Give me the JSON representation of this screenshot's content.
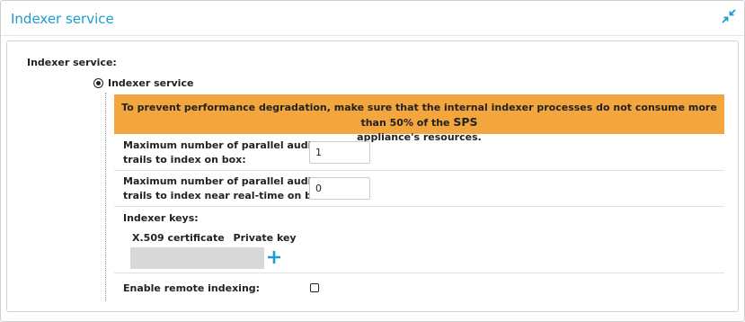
{
  "panel": {
    "title": "Indexer service",
    "collapse_icon": "collapse-arrows-icon"
  },
  "section": {
    "label": "Indexer service:",
    "option_label": "Indexer service",
    "option_selected": true
  },
  "warning": {
    "text_main": "To prevent performance degradation, make sure that the internal indexer processes do not consume more than 50% of the ",
    "text_sps": "SPS",
    "text_end": "appliance's resources."
  },
  "fields": {
    "max_parallel": {
      "label_line1": "Maximum number of parallel audit",
      "label_line2": "trails to index on box:",
      "value": "1"
    },
    "max_parallel_realtime": {
      "label_line1": "Maximum number of parallel audit",
      "label_line2": "trails to index near real-time on box:",
      "value": "0"
    }
  },
  "indexer_keys": {
    "label": "Indexer keys:",
    "col_cert": "X.509 certificate",
    "col_key": "Private key",
    "add_icon": "plus-icon"
  },
  "remote_indexing": {
    "label": "Enable remote indexing:",
    "checked": false
  },
  "colors": {
    "accent": "#1d9bd1",
    "warning_bg": "#f3a53e",
    "keys_cell_bg": "#d8d8d8"
  }
}
